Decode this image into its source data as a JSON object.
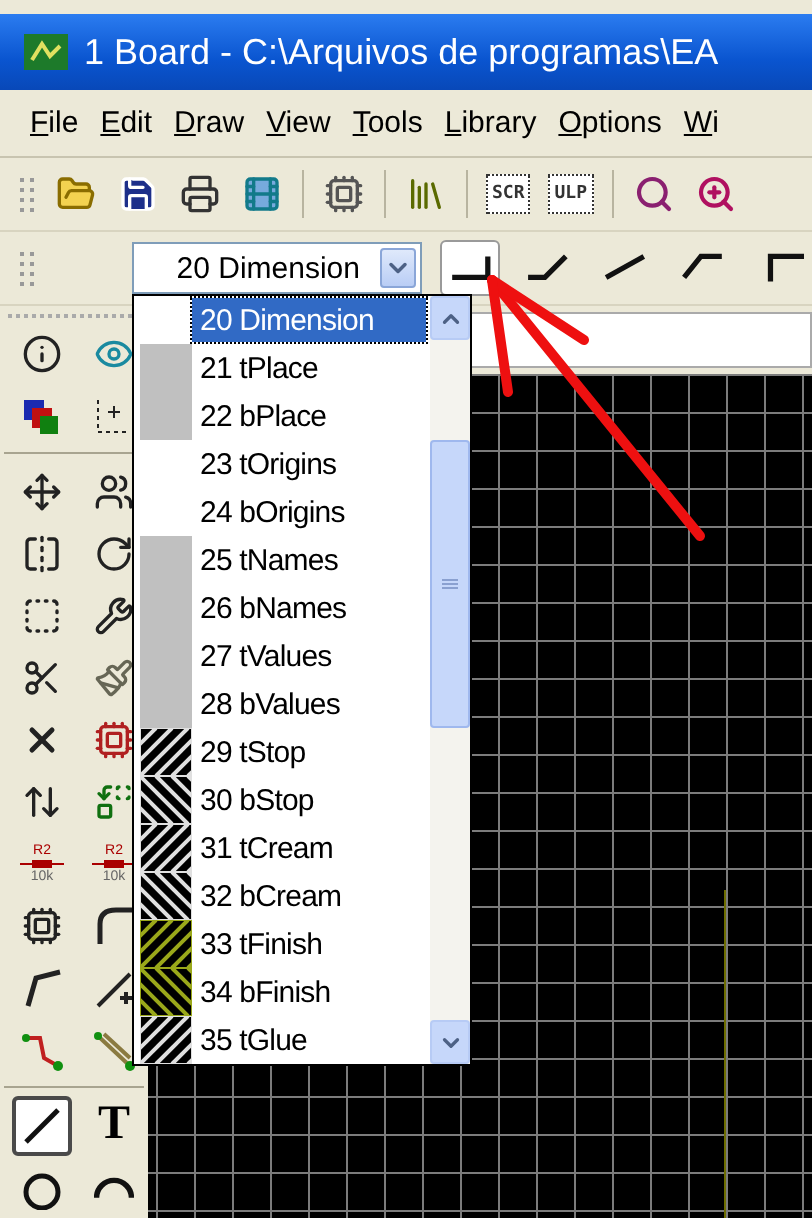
{
  "window": {
    "title": "1 Board - C:\\Arquivos de programas\\EA"
  },
  "menu": [
    "File",
    "Edit",
    "Draw",
    "View",
    "Tools",
    "Library",
    "Options",
    "Wi"
  ],
  "toolbar": [
    {
      "kind": "open"
    },
    {
      "kind": "save"
    },
    {
      "kind": "print"
    },
    {
      "kind": "cam"
    },
    {
      "kind": "sep"
    },
    {
      "kind": "schematic"
    },
    {
      "kind": "sep"
    },
    {
      "kind": "library"
    },
    {
      "kind": "sep"
    },
    {
      "kind": "script",
      "text": "SCR"
    },
    {
      "kind": "script",
      "text": "ULP"
    },
    {
      "kind": "sep"
    },
    {
      "kind": "zoom_fit"
    },
    {
      "kind": "zoom_in"
    }
  ],
  "layer_combo": {
    "value": "20 Dimension",
    "expanded": true
  },
  "bends": [
    {
      "selected": true
    },
    {
      "selected": false
    },
    {
      "selected": false
    },
    {
      "selected": false
    },
    {
      "selected": false
    }
  ],
  "layers": [
    {
      "label": "20 Dimension",
      "selected": true,
      "kind": "none"
    },
    {
      "label": "21 tPlace",
      "selected": false,
      "kind": "solid",
      "color": "#c0c0c0"
    },
    {
      "label": "22 bPlace",
      "selected": false,
      "kind": "solid",
      "color": "#c0c0c0"
    },
    {
      "label": "23 tOrigins",
      "selected": false,
      "kind": "none"
    },
    {
      "label": "24 bOrigins",
      "selected": false,
      "kind": "none"
    },
    {
      "label": "25 tNames",
      "selected": false,
      "kind": "solid",
      "color": "#c0c0c0"
    },
    {
      "label": "26 bNames",
      "selected": false,
      "kind": "solid",
      "color": "#c0c0c0"
    },
    {
      "label": "27 tValues",
      "selected": false,
      "kind": "solid",
      "color": "#c0c0c0"
    },
    {
      "label": "28 bValues",
      "selected": false,
      "kind": "solid",
      "color": "#c0c0c0"
    },
    {
      "label": "29 tStop",
      "selected": false,
      "kind": "hatch_right",
      "color": "#e0e0e0"
    },
    {
      "label": "30 bStop",
      "selected": false,
      "kind": "hatch_left",
      "color": "#e0e0e0"
    },
    {
      "label": "31 tCream",
      "selected": false,
      "kind": "hatch_right",
      "color": "#e0e0e0"
    },
    {
      "label": "32 bCream",
      "selected": false,
      "kind": "hatch_left",
      "color": "#e0e0e0"
    },
    {
      "label": "33 tFinish",
      "selected": false,
      "kind": "hatch_right",
      "color": "#9aa81a"
    },
    {
      "label": "34 bFinish",
      "selected": false,
      "kind": "hatch_left",
      "color": "#9aa81a"
    },
    {
      "label": "35 tGlue",
      "selected": false,
      "kind": "hatch_right",
      "color": "#e0e0e0"
    }
  ],
  "tools": [
    [
      {
        "kind": "info"
      },
      {
        "kind": "eye"
      }
    ],
    [
      {
        "kind": "layers"
      },
      {
        "kind": "mark"
      }
    ],
    [
      {
        "kind": "sep"
      }
    ],
    [
      {
        "kind": "move"
      },
      {
        "kind": "figures"
      }
    ],
    [
      {
        "kind": "mirror"
      },
      {
        "kind": "rotate"
      }
    ],
    [
      {
        "kind": "group"
      },
      {
        "kind": "wrench"
      }
    ],
    [
      {
        "kind": "scissors"
      },
      {
        "kind": "brush"
      }
    ],
    [
      {
        "kind": "delete"
      },
      {
        "kind": "gate"
      }
    ],
    [
      {
        "kind": "swap"
      },
      {
        "kind": "replace"
      }
    ],
    [
      {
        "kind": "resistor",
        "texts": [
          "R2",
          "10k"
        ]
      },
      {
        "kind": "resistor",
        "texts": [
          "R2",
          "10k"
        ]
      }
    ],
    [
      {
        "kind": "chip"
      },
      {
        "kind": "miter"
      }
    ],
    [
      {
        "kind": "split"
      },
      {
        "kind": "optimize"
      }
    ],
    [
      {
        "kind": "route"
      },
      {
        "kind": "ripup"
      }
    ],
    [
      {
        "kind": "sep"
      }
    ],
    [
      {
        "kind": "line",
        "selected": true
      },
      {
        "kind": "text",
        "text": "T"
      }
    ],
    [
      {
        "kind": "circle"
      },
      {
        "kind": "arc"
      }
    ]
  ],
  "annotation": {
    "kind": "arrow"
  }
}
